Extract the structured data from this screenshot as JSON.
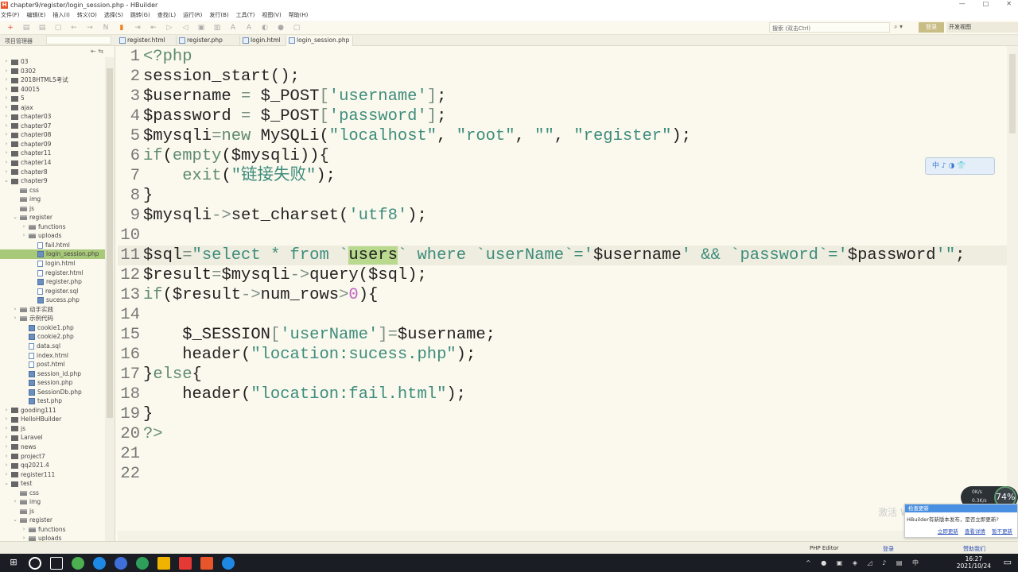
{
  "window": {
    "title": "chapter9/register/login_session.php - HBuilder",
    "app_logo": "H",
    "controls": [
      "—",
      "□",
      "✕"
    ]
  },
  "menu": [
    "文件(F)",
    "编辑(E)",
    "插入(I)",
    "转义(O)",
    "选择(S)",
    "跳转(G)",
    "查找(L)",
    "运行(R)",
    "发行(B)",
    "工具(T)",
    "视图(V)",
    "帮助(H)"
  ],
  "toolbar": {
    "icons": [
      "new-icon",
      "save-icon",
      "save-all-icon",
      "open-icon",
      "undo-icon",
      "redo-icon",
      "format-icon",
      "bookmark-icon",
      "indent-icon",
      "outdent-icon",
      "comment-icon",
      "uncomment-icon",
      "run-icon",
      "stop-icon",
      "font-larger-icon",
      "font-smaller-icon",
      "run-browser-icon",
      "chrome-icon",
      "preview-icon"
    ],
    "search_placeholder": "搜索 (双击Ctrl)",
    "login_label": "登录",
    "view_label": "开发视图"
  },
  "sidebar": {
    "title": "项目管理器",
    "tree": [
      {
        "d": 0,
        "a": ">",
        "t": "proj",
        "l": "03"
      },
      {
        "d": 0,
        "a": ">",
        "t": "proj",
        "l": "0302"
      },
      {
        "d": 0,
        "a": ">",
        "t": "proj",
        "l": "2018HTML5考试"
      },
      {
        "d": 0,
        "a": ">",
        "t": "proj",
        "l": "40015"
      },
      {
        "d": 0,
        "a": ">",
        "t": "proj",
        "l": "5"
      },
      {
        "d": 0,
        "a": ">",
        "t": "proj",
        "l": "ajax"
      },
      {
        "d": 0,
        "a": ">",
        "t": "proj",
        "l": "chapter03"
      },
      {
        "d": 0,
        "a": ">",
        "t": "proj",
        "l": "chapter07"
      },
      {
        "d": 0,
        "a": ">",
        "t": "proj",
        "l": "chapter08"
      },
      {
        "d": 0,
        "a": ">",
        "t": "proj",
        "l": "chapter09"
      },
      {
        "d": 0,
        "a": ">",
        "t": "proj",
        "l": "chapter11"
      },
      {
        "d": 0,
        "a": ">",
        "t": "proj",
        "l": "chapter14"
      },
      {
        "d": 0,
        "a": ">",
        "t": "proj",
        "l": "chapter8"
      },
      {
        "d": 0,
        "a": "v",
        "t": "proj",
        "l": "chapter9"
      },
      {
        "d": 1,
        "a": "",
        "t": "folder",
        "l": "css"
      },
      {
        "d": 1,
        "a": "",
        "t": "folder",
        "l": "img"
      },
      {
        "d": 1,
        "a": "",
        "t": "folder",
        "l": "js"
      },
      {
        "d": 1,
        "a": "v",
        "t": "folder",
        "l": "register"
      },
      {
        "d": 2,
        "a": ">",
        "t": "folder",
        "l": "functions"
      },
      {
        "d": 2,
        "a": ">",
        "t": "folder",
        "l": "uploads"
      },
      {
        "d": 3,
        "a": "",
        "t": "file",
        "l": "fail.html"
      },
      {
        "d": 3,
        "a": "",
        "t": "php",
        "l": "login_session.php",
        "sel": true
      },
      {
        "d": 3,
        "a": "",
        "t": "file",
        "l": "login.html"
      },
      {
        "d": 3,
        "a": "",
        "t": "file",
        "l": "register.html"
      },
      {
        "d": 3,
        "a": "",
        "t": "php",
        "l": "register.php"
      },
      {
        "d": 3,
        "a": "",
        "t": "file",
        "l": "register.sql"
      },
      {
        "d": 3,
        "a": "",
        "t": "php",
        "l": "sucess.php"
      },
      {
        "d": 1,
        "a": ">",
        "t": "folder",
        "l": "动手实践"
      },
      {
        "d": 1,
        "a": ">",
        "t": "folder",
        "l": "示例代码"
      },
      {
        "d": 2,
        "a": "",
        "t": "php",
        "l": "cookie1.php"
      },
      {
        "d": 2,
        "a": "",
        "t": "php",
        "l": "cookie2.php"
      },
      {
        "d": 2,
        "a": "",
        "t": "file",
        "l": "data.sql"
      },
      {
        "d": 2,
        "a": "",
        "t": "file",
        "l": "index.html"
      },
      {
        "d": 2,
        "a": "",
        "t": "file",
        "l": "post.html"
      },
      {
        "d": 2,
        "a": "",
        "t": "php",
        "l": "session_id.php"
      },
      {
        "d": 2,
        "a": "",
        "t": "php",
        "l": "session.php"
      },
      {
        "d": 2,
        "a": "",
        "t": "php",
        "l": "SessionDb.php"
      },
      {
        "d": 2,
        "a": "",
        "t": "php",
        "l": "test.php"
      },
      {
        "d": 0,
        "a": ">",
        "t": "proj",
        "l": "gooding111"
      },
      {
        "d": 0,
        "a": ">",
        "t": "proj",
        "l": "HelloHBuilder"
      },
      {
        "d": 0,
        "a": ">",
        "t": "proj",
        "l": "js"
      },
      {
        "d": 0,
        "a": ">",
        "t": "proj",
        "l": "Laravel"
      },
      {
        "d": 0,
        "a": ">",
        "t": "proj",
        "l": "news"
      },
      {
        "d": 0,
        "a": ">",
        "t": "proj",
        "l": "project7"
      },
      {
        "d": 0,
        "a": ">",
        "t": "proj",
        "l": "qq2021.4"
      },
      {
        "d": 0,
        "a": ">",
        "t": "proj",
        "l": "register111"
      },
      {
        "d": 0,
        "a": "v",
        "t": "proj",
        "l": "test"
      },
      {
        "d": 1,
        "a": "",
        "t": "folder",
        "l": "css"
      },
      {
        "d": 1,
        "a": ">",
        "t": "folder",
        "l": "img"
      },
      {
        "d": 1,
        "a": "",
        "t": "folder",
        "l": "js"
      },
      {
        "d": 1,
        "a": "v",
        "t": "folder",
        "l": "register"
      },
      {
        "d": 2,
        "a": ">",
        "t": "folder",
        "l": "functions"
      },
      {
        "d": 2,
        "a": ">",
        "t": "folder",
        "l": "uploads"
      }
    ]
  },
  "tabs": [
    {
      "label": "register.html"
    },
    {
      "label": "register.php"
    },
    {
      "label": "login.html"
    },
    {
      "label": "login_session.php",
      "active": true
    }
  ],
  "code": [
    [
      [
        "k",
        "<?php"
      ]
    ],
    [
      [
        "v",
        "session_start();"
      ]
    ],
    [
      [
        "v",
        "$username "
      ],
      [
        "o",
        "= "
      ],
      [
        "v",
        "$_POST"
      ],
      [
        "o",
        "["
      ],
      [
        "s",
        "'username'"
      ],
      [
        "o",
        "]"
      ],
      [
        "v",
        ";"
      ]
    ],
    [
      [
        "v",
        "$password "
      ],
      [
        "o",
        "= "
      ],
      [
        "v",
        "$_POST"
      ],
      [
        "o",
        "["
      ],
      [
        "s",
        "'password'"
      ],
      [
        "o",
        "]"
      ],
      [
        "v",
        ";"
      ]
    ],
    [
      [
        "v",
        "$mysqli"
      ],
      [
        "o",
        "="
      ],
      [
        "k",
        "new "
      ],
      [
        "v",
        "MySQLi("
      ],
      [
        "s",
        "\"localhost\""
      ],
      [
        "v",
        ", "
      ],
      [
        "s",
        "\"root\""
      ],
      [
        "v",
        ", "
      ],
      [
        "s",
        "\"\""
      ],
      [
        "v",
        ", "
      ],
      [
        "s",
        "\"register\""
      ],
      [
        "v",
        ");"
      ]
    ],
    [
      [
        "k",
        "if"
      ],
      [
        "v",
        "("
      ],
      [
        "k",
        "empty"
      ],
      [
        "v",
        "($mysqli)){"
      ]
    ],
    [
      [
        "v",
        "    "
      ],
      [
        "k",
        "exit"
      ],
      [
        "v",
        "("
      ],
      [
        "s",
        "\"链接失败\""
      ],
      [
        "v",
        ");"
      ]
    ],
    [
      [
        "v",
        "}"
      ]
    ],
    [
      [
        "v",
        "$mysqli"
      ],
      [
        "o",
        "->"
      ],
      [
        "v",
        "set_charset("
      ],
      [
        "s",
        "'utf8'"
      ],
      [
        "v",
        ");"
      ]
    ],
    [],
    [
      [
        "v",
        "$sql"
      ],
      [
        "o",
        "="
      ],
      [
        "s",
        "\"select * from `"
      ],
      [
        "h",
        "users"
      ],
      [
        "s",
        "` where `userName`='"
      ],
      [
        "v",
        "$username"
      ],
      [
        "s",
        "' && `password`='"
      ],
      [
        "v",
        "$password"
      ],
      [
        "s",
        "'\""
      ],
      [
        "v",
        ";"
      ]
    ],
    [
      [
        "v",
        "$result"
      ],
      [
        "o",
        "="
      ],
      [
        "v",
        "$mysqli"
      ],
      [
        "o",
        "->"
      ],
      [
        "v",
        "query($sql);"
      ]
    ],
    [
      [
        "k",
        "if"
      ],
      [
        "v",
        "($result"
      ],
      [
        "o",
        "->"
      ],
      [
        "v",
        "num_rows"
      ],
      [
        "o",
        ">"
      ],
      [
        "n",
        "0"
      ],
      [
        "v",
        "){"
      ]
    ],
    [],
    [
      [
        "v",
        "    $_SESSION"
      ],
      [
        "o",
        "["
      ],
      [
        "s",
        "'userName'"
      ],
      [
        "o",
        "]"
      ],
      [
        "o",
        "="
      ],
      [
        "v",
        "$username;"
      ]
    ],
    [
      [
        "v",
        "    header("
      ],
      [
        "s",
        "\"location:sucess.php\""
      ],
      [
        "v",
        ");"
      ]
    ],
    [
      [
        "v",
        "}"
      ],
      [
        "k",
        "else"
      ],
      [
        "v",
        "{"
      ]
    ],
    [
      [
        "v",
        "    header("
      ],
      [
        "s",
        "\"location:fail.html\""
      ],
      [
        "v",
        ");"
      ]
    ],
    [
      [
        "v",
        "}"
      ]
    ],
    [
      [
        "k",
        "?>"
      ]
    ],
    [],
    []
  ],
  "current_line": 11,
  "status": {
    "editor_type": "PHP Editor",
    "login": "登录",
    "sponsor": "赞助我们"
  },
  "notification": {
    "title": "检查更新",
    "message": "HBuilder有新版本发布，是否立即更新?",
    "actions": [
      "立即更新",
      "查看详情",
      "暂不更新"
    ]
  },
  "network": {
    "up": "0K/s",
    "down": "0.3K/s",
    "percent": "74%"
  },
  "ime_bar": "中 ♪ ◑ 👕",
  "watermark": "激活 W",
  "taskbar": {
    "time": "16:27",
    "date": "2021/10/24",
    "ime": "中"
  },
  "colors": {
    "keyword": "#5f8a72",
    "string": "#3d8c7c",
    "number": "#c264c2",
    "selection": "#a9c97a",
    "highlight": "#b9d98f"
  }
}
